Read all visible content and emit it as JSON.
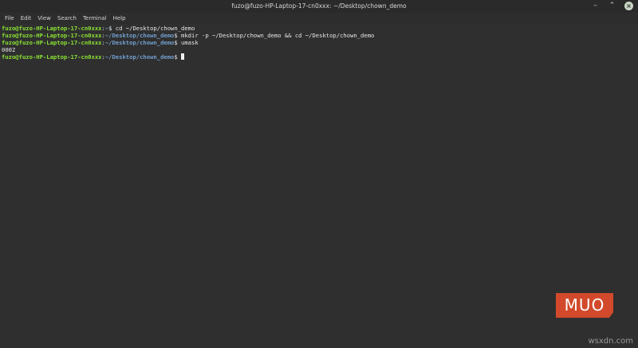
{
  "window": {
    "title": "fuzo@fuzo-HP-Laptop-17-cn0xxx: ~/Desktop/chown_demo"
  },
  "menu": {
    "items": [
      "File",
      "Edit",
      "View",
      "Search",
      "Terminal",
      "Help"
    ]
  },
  "terminal": {
    "lines": [
      {
        "user": "fuzo@fuzo-HP-Laptop-17-cn0xxx",
        "sep": ":",
        "path": "~",
        "prompt": "$ ",
        "cmd": "cd ~/Desktop/chown_demo"
      },
      {
        "user": "fuzo@fuzo-HP-Laptop-17-cn0xxx",
        "sep": ":",
        "path": "~/Desktop/chown_demo",
        "prompt": "$ ",
        "cmd": "mkdir -p ~/Desktop/chown_demo && cd ~/Desktop/chown_demo"
      },
      {
        "user": "fuzo@fuzo-HP-Laptop-17-cn0xxx",
        "sep": ":",
        "path": "~/Desktop/chown_demo",
        "prompt": "$ ",
        "cmd": "umask"
      },
      {
        "output": "0002"
      },
      {
        "user": "fuzo@fuzo-HP-Laptop-17-cn0xxx",
        "sep": ":",
        "path": "~/Desktop/chown_demo",
        "prompt": "$ ",
        "cmd": ""
      }
    ]
  },
  "branding": {
    "logo_text": "MUO",
    "logo_color": "#d24a2b",
    "watermark": "wsxdn.com"
  },
  "colors": {
    "user": "#8ae234",
    "path": "#729fcf",
    "background": "#2f2f2f"
  }
}
